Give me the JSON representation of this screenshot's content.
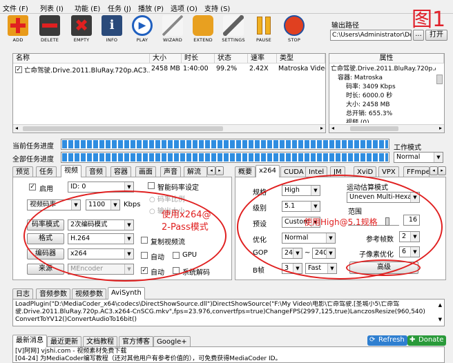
{
  "menu": [
    "文件 (F)",
    "列表 (I)",
    "功能 (E)",
    "任务 (J)",
    "播放 (P)",
    "选项 (O)",
    "支持 (S)"
  ],
  "toolbar": [
    "ADD",
    "DELETE",
    "EMPTY",
    "INFO",
    "PLAY",
    "WIZARD",
    "EXTEND",
    "SETTINGS",
    "PAUSE",
    "STOP"
  ],
  "output": {
    "label": "输出路径",
    "path": "C:\\Users\\Administrator\\Desk",
    "browse": "...",
    "open": "打开"
  },
  "figure_label": "图1",
  "filelist": {
    "headers": [
      "名称",
      "大小",
      "时长",
      "状态",
      "速率",
      "类型"
    ],
    "row": {
      "name": "亡命驾驶.Drive.2011.BluRay.720p.AC3....",
      "size": "2458 MB",
      "duration": "1:40:00",
      "status": "99.2%",
      "rate": "2.42X",
      "type": "Matroska Video"
    }
  },
  "props": {
    "header": "属性",
    "items": [
      "亡命驾驶.Drive.2011.BluRay.720p.A",
      "容器: Matroska",
      "码率: 3409 Kbps",
      "时长: 6000.0 秒",
      "大小: 2458 MB",
      "总开销: 655.3%",
      "视频 (0)..."
    ]
  },
  "progress": {
    "current": "当前任务进度",
    "all": "全部任务进度",
    "current_pct": 1.0,
    "all_pct": 1.0
  },
  "workmode": {
    "label": "工作模式",
    "value": "Normal"
  },
  "left_tabs": [
    "预览",
    "任务",
    "视频",
    "音频",
    "容器",
    "画面",
    "声音",
    "解流"
  ],
  "video": {
    "enable": "启用",
    "id": "ID: 0",
    "smart_rate": "智能码率设定",
    "rate_mode": "视频码率",
    "bitrate": "1100",
    "kbps": "Kbps",
    "rate_ratio": "码率比例",
    "output_size": "输出大小",
    "labels": [
      "码率模式",
      "格式",
      "编码器",
      "来源"
    ],
    "values": [
      "2次编码模式",
      "H.264",
      "x264",
      "MEncoder"
    ],
    "copy_stream": "复制视频流",
    "auto": "自动",
    "gpu": "GPU",
    "sysdecode": "系统解码",
    "annotation_line1": "使用x264@",
    "annotation_line2": "2-Pass模式"
  },
  "right_tabs": [
    "概要",
    "x264",
    "CUDA",
    "Intel",
    "JM",
    "XviD",
    "VPX",
    "FFmpeg"
  ],
  "x264": {
    "profile_label": "规格",
    "profile": "High",
    "level_label": "级别",
    "level": "5.1",
    "preset_label": "预设",
    "preset": "Custom",
    "tune_label": "优化",
    "tune": "Normal",
    "gop_label": "GOP",
    "gop_min": "24",
    "gop_tilde": "~",
    "gop_max": "240",
    "bframes_label": "B帧",
    "bframes": "3",
    "bmode": "Fast",
    "me_label": "运动估算模式",
    "me": "Uneven Multi-Hexagon",
    "range_label": "范围",
    "range": "16",
    "ref_label": "参考帧数",
    "ref": "2",
    "subme_label": "子像素优化",
    "subme": "6",
    "advanced": "高级",
    "annotation": "使用High@5.1规格"
  },
  "bottom_tabs": [
    "日志",
    "音频参数",
    "视频参数",
    "AviSynth"
  ],
  "avisynth": [
    "LoadPlugin(\"D:\\MediaCoder_x64\\codecs\\DirectShowSource.dll\")DirectShowSource(\"F:\\My Video\\电影\\亡命驾驶.[圣城小5\\亡命驾",
    "驶.Drive.2011.BluRay.720p.AC3.x264-CnSCG.mkv\",fps=23.976,convertfps=true)ChangeFPS(2997,125,true)LanczosResize(960,540)",
    "ConvertToYV12()ConvertAudioTo16bit()"
  ],
  "news_tabs": [
    "最新消息",
    "最近更新",
    "文档教程",
    "官方博客",
    "Google+"
  ],
  "refresh": "Refresh",
  "donate": "Donate",
  "news": [
    "[V]阿网] vjshi.com - 视频素材免费下载",
    "[04-24] 为MediaCoder编写教程（还对其他用户有参考价值的），可免费获得MediaCoder ID。"
  ],
  "colors": {
    "accent": "#2f8de0",
    "annotation": "#e02020"
  }
}
